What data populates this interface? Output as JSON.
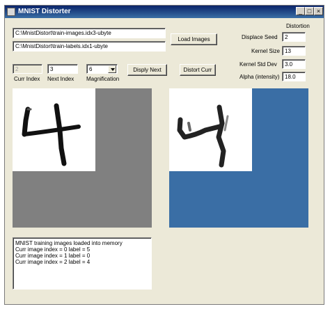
{
  "window": {
    "title": "MNIST Distorter"
  },
  "titlebar_buttons": {
    "minimize": "_",
    "maximize": "□",
    "close": "×"
  },
  "files": {
    "images_path": "C:\\MnistDistort\\train-images.idx3-ubyte",
    "labels_path": "C:\\MnistDistort\\train-labels.idx1-ubyte"
  },
  "buttons": {
    "load_images": "Load Images",
    "display_next": "Disply Next",
    "distort_curr": "Distort Curr"
  },
  "indices": {
    "curr_index": "2",
    "curr_index_label": "Curr Index",
    "next_index": "3",
    "next_index_label": "Next Index",
    "magnification": "6",
    "magnification_label": "Magnification"
  },
  "distortion": {
    "heading": "Distortion",
    "displace_seed_label": "Displace Seed",
    "displace_seed": "2",
    "kernel_size_label": "Kernel Size",
    "kernel_size": "13",
    "kernel_std_dev_label": "Kernel Std Dev",
    "kernel_std_dev": "3.0",
    "alpha_label": "Alpha (intensity)",
    "alpha": "18.0"
  },
  "log": {
    "lines": [
      "MNIST training images loaded into memory",
      "Curr image index = 0 label = 5",
      "Curr image index = 1 label = 0",
      "Curr image index = 2 label = 4"
    ]
  },
  "colors": {
    "original_panel_bg": "#808080",
    "distorted_panel_bg": "#3a6ea5",
    "digit_bg": "#ffffff"
  }
}
